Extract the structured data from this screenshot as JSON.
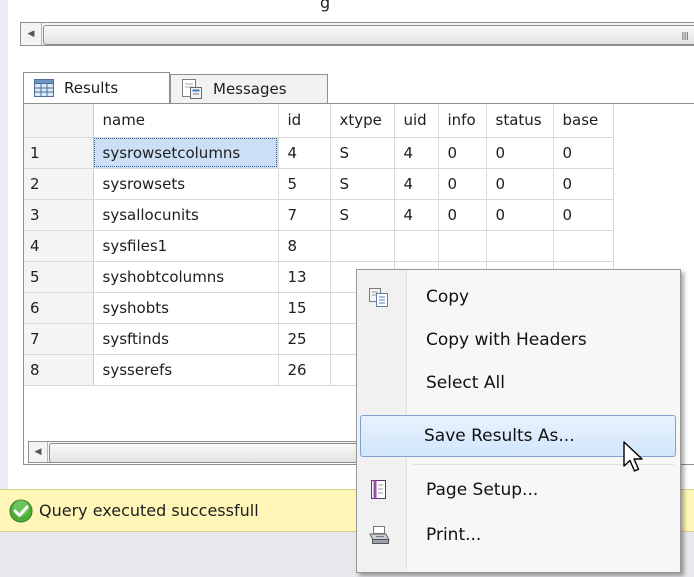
{
  "top_caption": "g",
  "tabs": [
    {
      "label": "Results",
      "icon": "grid-icon"
    },
    {
      "label": "Messages",
      "icon": "messages-icon"
    }
  ],
  "grid": {
    "columns": [
      "",
      "name",
      "id",
      "xtype",
      "uid",
      "info",
      "status",
      "base"
    ],
    "rows": [
      [
        "1",
        "sysrowsetcolumns",
        "4",
        "S",
        "4",
        "0",
        "0",
        "0"
      ],
      [
        "2",
        "sysrowsets",
        "5",
        "S",
        "4",
        "0",
        "0",
        "0"
      ],
      [
        "3",
        "sysallocunits",
        "7",
        "S",
        "4",
        "0",
        "0",
        "0"
      ],
      [
        "4",
        "sysfiles1",
        "8",
        "",
        "",
        "",
        "",
        ""
      ],
      [
        "5",
        "syshobtcolumns",
        "13",
        "",
        "",
        "",
        "",
        ""
      ],
      [
        "6",
        "syshobts",
        "15",
        "",
        "",
        "",
        "",
        ""
      ],
      [
        "7",
        "sysftinds",
        "25",
        "",
        "",
        "",
        "",
        ""
      ],
      [
        "8",
        "sysserefs",
        "26",
        "",
        "",
        "",
        "",
        ""
      ]
    ],
    "selected_cell": "sysrowsetcolumns"
  },
  "scroll_grip": "III",
  "status": {
    "text": "Query executed successfull",
    "icon": "check-circle-icon",
    "color": "#fff6b8"
  },
  "context_menu": {
    "items": [
      {
        "label": "Copy",
        "icon": "copy-icon"
      },
      {
        "label": "Copy with Headers",
        "icon": ""
      },
      {
        "label": "Select All",
        "icon": ""
      },
      {
        "label": "Save Results As...",
        "icon": "",
        "highlighted": true
      },
      {
        "label": "Page Setup...",
        "icon": "page-setup-icon"
      },
      {
        "label": "Print...",
        "icon": "printer-icon"
      }
    ]
  }
}
